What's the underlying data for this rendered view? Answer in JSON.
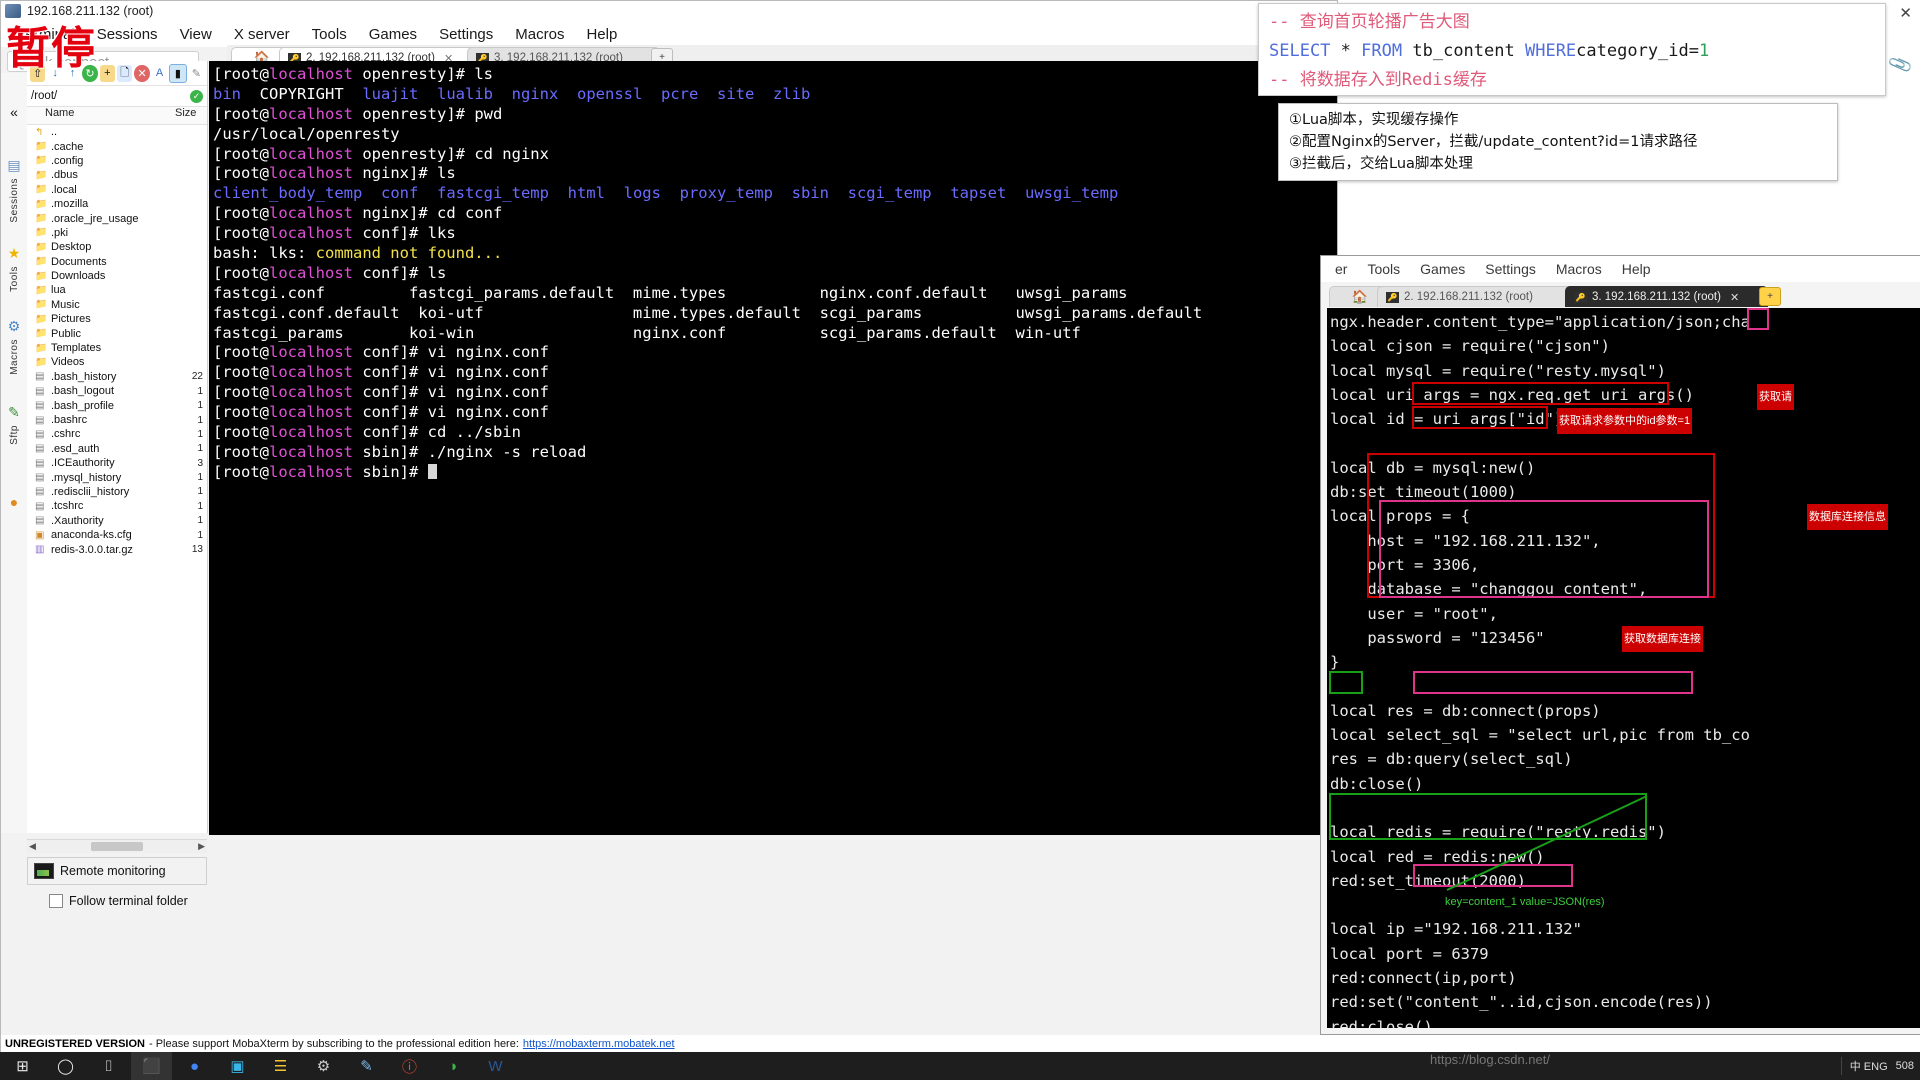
{
  "window_main": {
    "title": "192.168.211.132 (root)",
    "menus": [
      "Terminal",
      "Sessions",
      "View",
      "X server",
      "Tools",
      "Games",
      "Settings",
      "Macros",
      "Help"
    ],
    "quick_connect_placeholder": "Quick connect...",
    "rail": [
      {
        "label": "Sessions",
        "icon": "sessions-icon",
        "glyph": "▤"
      },
      {
        "label": "Tools",
        "icon": "star-icon",
        "glyph": "★"
      },
      {
        "label": "Macros",
        "icon": "tools-icon",
        "glyph": "⚒"
      },
      {
        "label": "Sftp",
        "icon": "macros-icon",
        "glyph": "✎"
      },
      {
        "label": "",
        "icon": "globe-icon",
        "glyph": "●"
      }
    ],
    "sftp": {
      "toolbar_icons": [
        "up-folder-icon",
        "download-icon",
        "upload-icon",
        "refresh-icon",
        "new-folder-icon",
        "new-file-icon",
        "delete-icon",
        "text-mode-icon",
        "usb-icon",
        "edit-icon"
      ],
      "path": "/root/",
      "status": "ok-check-icon",
      "columns": [
        "Name",
        "Size"
      ],
      "files": [
        {
          "icon": "folder-up-icon",
          "name": "..",
          "size": ""
        },
        {
          "icon": "folder-icon",
          "name": ".cache",
          "size": ""
        },
        {
          "icon": "folder-icon",
          "name": ".config",
          "size": ""
        },
        {
          "icon": "folder-icon",
          "name": ".dbus",
          "size": ""
        },
        {
          "icon": "folder-icon",
          "name": ".local",
          "size": ""
        },
        {
          "icon": "folder-icon",
          "name": ".mozilla",
          "size": ""
        },
        {
          "icon": "folder-icon",
          "name": ".oracle_jre_usage",
          "size": ""
        },
        {
          "icon": "folder-icon",
          "name": ".pki",
          "size": ""
        },
        {
          "icon": "folder-icon",
          "name": "Desktop",
          "size": ""
        },
        {
          "icon": "folder-icon",
          "name": "Documents",
          "size": ""
        },
        {
          "icon": "folder-icon",
          "name": "Downloads",
          "size": ""
        },
        {
          "icon": "folder-icon",
          "name": "lua",
          "size": ""
        },
        {
          "icon": "folder-icon",
          "name": "Music",
          "size": ""
        },
        {
          "icon": "folder-icon",
          "name": "Pictures",
          "size": ""
        },
        {
          "icon": "folder-icon",
          "name": "Public",
          "size": ""
        },
        {
          "icon": "folder-icon",
          "name": "Templates",
          "size": ""
        },
        {
          "icon": "folder-icon",
          "name": "Videos",
          "size": ""
        },
        {
          "icon": "file-icon",
          "name": ".bash_history",
          "size": "22"
        },
        {
          "icon": "file-icon",
          "name": ".bash_logout",
          "size": "1"
        },
        {
          "icon": "file-icon",
          "name": ".bash_profile",
          "size": "1"
        },
        {
          "icon": "file-icon",
          "name": ".bashrc",
          "size": "1"
        },
        {
          "icon": "file-icon",
          "name": ".cshrc",
          "size": "1"
        },
        {
          "icon": "file-icon",
          "name": ".esd_auth",
          "size": "1"
        },
        {
          "icon": "file-icon",
          "name": ".ICEauthority",
          "size": "3"
        },
        {
          "icon": "file-icon",
          "name": ".mysql_history",
          "size": "1"
        },
        {
          "icon": "file-icon",
          "name": ".redisclii_history",
          "size": "1"
        },
        {
          "icon": "file-icon",
          "name": ".tcshrc",
          "size": "1"
        },
        {
          "icon": "file-icon",
          "name": ".Xauthority",
          "size": "1"
        },
        {
          "icon": "cfg-icon",
          "name": "anaconda-ks.cfg",
          "size": "1"
        },
        {
          "icon": "archive-icon",
          "name": "redis-3.0.0.tar.gz",
          "size": "13"
        }
      ],
      "remote_monitoring": "Remote monitoring",
      "follow_terminal_folder": "Follow terminal folder"
    },
    "tabs": [
      {
        "label": "",
        "icon": "home-icon",
        "active": false
      },
      {
        "label": "2. 192.168.211.132 (root)",
        "icon": "key-icon",
        "active": true,
        "closable": true
      },
      {
        "label": "3. 192.168.211.132 (root)",
        "icon": "key-icon",
        "active": false
      }
    ],
    "new_tab_label": "+",
    "status_bar": {
      "unregistered": "UNREGISTERED VERSION",
      "message": "- Please support MobaXterm by subscribing to the professional edition here:",
      "link": "https://mobaxterm.mobatek.net"
    }
  },
  "terminal_main": {
    "lines": [
      {
        "parts": [
          {
            "t": "[root@",
            "c": "c-br"
          },
          {
            "t": "localhost",
            "c": "c-host"
          },
          {
            "t": " openresty]# ls",
            "c": "c-br"
          }
        ]
      },
      {
        "parts": [
          {
            "t": "bin",
            "c": "c-dir"
          },
          {
            "t": "  COPYRIGHT  ",
            "c": "c-wht"
          },
          {
            "t": "luajit",
            "c": "c-dir"
          },
          {
            "t": "  ",
            "c": "c-wht"
          },
          {
            "t": "lualib",
            "c": "c-dir"
          },
          {
            "t": "  ",
            "c": "c-wht"
          },
          {
            "t": "nginx",
            "c": "c-dir"
          },
          {
            "t": "  ",
            "c": "c-wht"
          },
          {
            "t": "openssl",
            "c": "c-dir"
          },
          {
            "t": "  ",
            "c": "c-wht"
          },
          {
            "t": "pcre",
            "c": "c-dir"
          },
          {
            "t": "  ",
            "c": "c-wht"
          },
          {
            "t": "site",
            "c": "c-dir"
          },
          {
            "t": "  ",
            "c": "c-wht"
          },
          {
            "t": "zlib",
            "c": "c-dir"
          }
        ]
      },
      {
        "parts": [
          {
            "t": "[root@",
            "c": "c-br"
          },
          {
            "t": "localhost",
            "c": "c-host"
          },
          {
            "t": " openresty]# pwd",
            "c": "c-br"
          }
        ]
      },
      {
        "parts": [
          {
            "t": "/usr/local/openresty",
            "c": "c-wht"
          }
        ]
      },
      {
        "parts": [
          {
            "t": "[root@",
            "c": "c-br"
          },
          {
            "t": "localhost",
            "c": "c-host"
          },
          {
            "t": " openresty]# cd nginx",
            "c": "c-br"
          }
        ]
      },
      {
        "parts": [
          {
            "t": "[root@",
            "c": "c-br"
          },
          {
            "t": "localhost",
            "c": "c-host"
          },
          {
            "t": " nginx]# ls",
            "c": "c-br"
          }
        ]
      },
      {
        "parts": [
          {
            "t": "client_body_temp",
            "c": "c-dir"
          },
          {
            "t": "  ",
            "c": "c-wht"
          },
          {
            "t": "conf",
            "c": "c-dir"
          },
          {
            "t": "  ",
            "c": "c-wht"
          },
          {
            "t": "fastcgi_temp",
            "c": "c-dir"
          },
          {
            "t": "  ",
            "c": "c-wht"
          },
          {
            "t": "html",
            "c": "c-dir"
          },
          {
            "t": "  ",
            "c": "c-wht"
          },
          {
            "t": "logs",
            "c": "c-dir"
          },
          {
            "t": "  ",
            "c": "c-wht"
          },
          {
            "t": "proxy_temp",
            "c": "c-dir"
          },
          {
            "t": "  ",
            "c": "c-wht"
          },
          {
            "t": "sbin",
            "c": "c-dir"
          },
          {
            "t": "  ",
            "c": "c-wht"
          },
          {
            "t": "scgi_temp",
            "c": "c-dir"
          },
          {
            "t": "  ",
            "c": "c-wht"
          },
          {
            "t": "tapset",
            "c": "c-dir"
          },
          {
            "t": "  ",
            "c": "c-wht"
          },
          {
            "t": "uwsgi_temp",
            "c": "c-dir"
          }
        ]
      },
      {
        "parts": [
          {
            "t": "[root@",
            "c": "c-br"
          },
          {
            "t": "localhost",
            "c": "c-host"
          },
          {
            "t": " nginx]# cd conf",
            "c": "c-br"
          }
        ]
      },
      {
        "parts": [
          {
            "t": "[root@",
            "c": "c-br"
          },
          {
            "t": "localhost",
            "c": "c-host"
          },
          {
            "t": " conf]# lks",
            "c": "c-br"
          }
        ]
      },
      {
        "parts": [
          {
            "t": "bash: lks: ",
            "c": "c-wht"
          },
          {
            "t": "command not found...",
            "c": "c-yel"
          }
        ]
      },
      {
        "parts": [
          {
            "t": "[root@",
            "c": "c-br"
          },
          {
            "t": "localhost",
            "c": "c-host"
          },
          {
            "t": " conf]# ls",
            "c": "c-br"
          }
        ]
      },
      {
        "parts": [
          {
            "t": "fastcgi.conf         fastcgi_params.default  mime.types          nginx.conf.default   uwsgi_params",
            "c": "c-wht"
          }
        ]
      },
      {
        "parts": [
          {
            "t": "fastcgi.conf.default  koi-utf                mime.types.default  scgi_params          uwsgi_params.default",
            "c": "c-wht"
          }
        ]
      },
      {
        "parts": [
          {
            "t": "fastcgi_params       koi-win                 nginx.conf          scgi_params.default  win-utf",
            "c": "c-wht"
          }
        ]
      },
      {
        "parts": [
          {
            "t": "[root@",
            "c": "c-br"
          },
          {
            "t": "localhost",
            "c": "c-host"
          },
          {
            "t": " conf]# vi nginx.conf",
            "c": "c-br"
          }
        ]
      },
      {
        "parts": [
          {
            "t": "[root@",
            "c": "c-br"
          },
          {
            "t": "localhost",
            "c": "c-host"
          },
          {
            "t": " conf]# vi nginx.conf",
            "c": "c-br"
          }
        ]
      },
      {
        "parts": [
          {
            "t": "[root@",
            "c": "c-br"
          },
          {
            "t": "localhost",
            "c": "c-host"
          },
          {
            "t": " conf]# vi nginx.conf",
            "c": "c-br"
          }
        ]
      },
      {
        "parts": [
          {
            "t": "[root@",
            "c": "c-br"
          },
          {
            "t": "localhost",
            "c": "c-host"
          },
          {
            "t": " conf]# vi nginx.conf",
            "c": "c-br"
          }
        ]
      },
      {
        "parts": [
          {
            "t": "[root@",
            "c": "c-br"
          },
          {
            "t": "localhost",
            "c": "c-host"
          },
          {
            "t": " conf]# cd ../sbin",
            "c": "c-br"
          }
        ]
      },
      {
        "parts": [
          {
            "t": "[root@",
            "c": "c-br"
          },
          {
            "t": "localhost",
            "c": "c-host"
          },
          {
            "t": " sbin]# ./nginx -s reload",
            "c": "c-br"
          }
        ]
      },
      {
        "parts": [
          {
            "t": "[root@",
            "c": "c-br"
          },
          {
            "t": "localhost",
            "c": "c-host"
          },
          {
            "t": " sbin]# ",
            "c": "c-br"
          }
        ],
        "cursor": true
      }
    ]
  },
  "window_right": {
    "menus": [
      "er",
      "Tools",
      "Games",
      "Settings",
      "Macros",
      "Help"
    ],
    "tabs": [
      {
        "label": "",
        "icon": "home-icon",
        "active": false
      },
      {
        "label": "2. 192.168.211.132 (root)",
        "icon": "key-icon",
        "active": false
      },
      {
        "label": "3. 192.168.211.132 (root)",
        "icon": "key-icon",
        "active": true,
        "closable": true
      }
    ],
    "new_tab_label": "+",
    "scroll_up_icon": "chevron-up-icon",
    "scroll_down_icon": "chevron-down-icon"
  },
  "terminal_right": {
    "lines": [
      "ngx.header.content_type=\"application/json;cha",
      "local cjson = require(\"cjson\")",
      "local mysql = require(\"resty.mysql\")",
      "local uri_args = ngx.req.get_uri_args()",
      "local id = uri_args[\"id\"]",
      "",
      "local db = mysql:new()",
      "db:set_timeout(1000)",
      "local props = {",
      "    host = \"192.168.211.132\",",
      "    port = 3306,",
      "    database = \"changgou_content\",",
      "    user = \"root\",",
      "    password = \"123456\"",
      "}",
      "",
      "local res = db:connect(props)",
      "local select_sql = \"select url,pic from tb_co",
      "res = db:query(select_sql)",
      "db:close()",
      "",
      "local redis = require(\"resty.redis\")",
      "local red = redis:new()",
      "red:set_timeout(2000)",
      "",
      "local ip =\"192.168.211.132\"",
      "local port = 6379",
      "red:connect(ip,port)",
      "red:set(\"content_\"..id,cjson.encode(res))",
      "red:close()"
    ],
    "annotations": [
      {
        "name": "uri-args-note",
        "text": "获取请",
        "color": "#cc0000"
      },
      {
        "name": "id-param-note",
        "text": "获取请求参数中的id参数=1",
        "color": "#cc0000"
      },
      {
        "name": "db-conn-note",
        "text": "数据库连接信息",
        "color": "#cc0000"
      },
      {
        "name": "get-db-conn-note",
        "text": "获取数据库连接",
        "color": "#cc0000"
      },
      {
        "name": "redis-keyvalue-note",
        "text": "key=content_1   value=JSON(res)",
        "color": "#3ecf3e"
      }
    ]
  },
  "overlay_sql": {
    "comment1": "-- 查询首页轮播广告大图",
    "sql_keyword1": "SELECT",
    "sql_star": "*",
    "sql_keyword2": "FROM",
    "sql_table": "tb_content",
    "sql_keyword3": "WHERE",
    "sql_where_col": "category_id=",
    "sql_where_val": "1",
    "comment2": "-- 将数据存入到Redis缓存"
  },
  "overlay_notes": {
    "line1": "①Lua脚本，实现缓存操作",
    "line2": "②配置Nginx的Server，拦截/update_content?id=1请求路径",
    "line3": "③拦截后，交给Lua脚本处理"
  },
  "watermark": {
    "text": "暂停",
    "color": "#e3000f"
  },
  "taskbar": {
    "items": [
      {
        "name": "start-button",
        "icon": "windows-icon",
        "glyph": "⊞",
        "active": false
      },
      {
        "name": "cortana-search",
        "icon": "circle-search-icon",
        "glyph": "◯",
        "active": false
      },
      {
        "name": "task-view",
        "icon": "task-view-icon",
        "glyph": "⌷",
        "active": false
      },
      {
        "name": "mobaxterm-task",
        "icon": "mobaxterm-icon",
        "glyph": "⬛",
        "active": true
      },
      {
        "name": "chrome-task",
        "icon": "chrome-icon",
        "glyph": "●",
        "active": false
      },
      {
        "name": "photos-task",
        "icon": "photos-icon",
        "glyph": "▣",
        "active": false
      },
      {
        "name": "explorer-task",
        "icon": "folder-icon",
        "glyph": "☰",
        "active": false
      },
      {
        "name": "settings-task",
        "icon": "gear-icon",
        "glyph": "⚙",
        "active": false
      },
      {
        "name": "editor-task",
        "icon": "editor-icon",
        "glyph": "✎",
        "active": false
      },
      {
        "name": "idea-task",
        "icon": "idea-icon",
        "glyph": "ⓘ",
        "active": false
      },
      {
        "name": "navicat-task",
        "icon": "navicat-icon",
        "glyph": "◑",
        "active": false
      },
      {
        "name": "word-task",
        "icon": "word-icon",
        "glyph": "W",
        "active": false
      }
    ],
    "tray": {
      "watermark": "https://blog.csdn.net/",
      "language": "中 ENG",
      "time": "508"
    }
  },
  "window_controls": {
    "close": "✕",
    "clip": "📎"
  }
}
